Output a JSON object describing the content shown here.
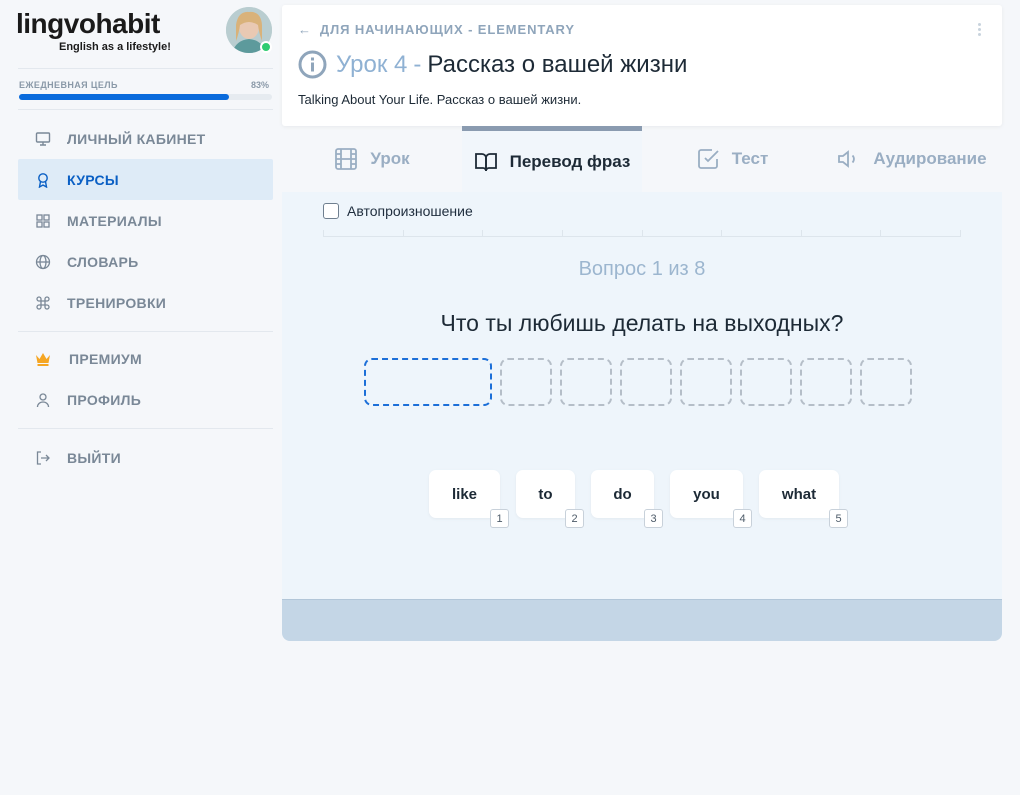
{
  "brand": {
    "name": "lingvohabit",
    "tagline": "English as a lifestyle!"
  },
  "daily_goal": {
    "label": "ЕЖЕДНЕВНАЯ ЦЕЛЬ",
    "percent_text": "83%",
    "progress": 0.83
  },
  "nav": {
    "cabinet": {
      "label": "ЛИЧНЫЙ КАБИНЕТ",
      "icon": "monitor-icon"
    },
    "courses": {
      "label": "КУРСЫ",
      "icon": "award-icon"
    },
    "materials": {
      "label": "МАТЕРИАЛЫ",
      "icon": "grid-icon"
    },
    "dictionary": {
      "label": "СЛОВАРЬ",
      "icon": "globe-icon"
    },
    "trainings": {
      "label": "ТРЕНИРОВКИ",
      "icon": "command-icon"
    },
    "premium": {
      "label": "ПРЕМИУМ",
      "icon": "crown-icon"
    },
    "profile": {
      "label": "ПРОФИЛЬ",
      "icon": "user-icon"
    },
    "logout": {
      "label": "ВЫЙТИ",
      "icon": "logout-icon"
    }
  },
  "header": {
    "breadcrumb": "ДЛЯ НАЧИНАЮЩИХ - ELEMENTARY",
    "lesson_number": "Урок 4",
    "lesson_dash": "-",
    "lesson_title": "Рассказ о вашей жизни",
    "subtitle": "Talking About Your Life. Рассказ о вашей жизни."
  },
  "tabs": {
    "lesson": "Урок",
    "phrases": "Перевод фраз",
    "test": "Тест",
    "listening": "Аудирование"
  },
  "exercise": {
    "autopronounce_label": "Автопроизношение",
    "question_counter": "Вопрос 1 из 8",
    "question": "Что ты любишь делать на выходных?",
    "words": [
      {
        "text": "like",
        "key": "1"
      },
      {
        "text": "to",
        "key": "2"
      },
      {
        "text": "do",
        "key": "3"
      },
      {
        "text": "you",
        "key": "4"
      },
      {
        "text": "what",
        "key": "5"
      }
    ]
  },
  "colors": {
    "accent": "#0a6bdc",
    "premium": "#f5a623",
    "online": "#2ecc71"
  }
}
